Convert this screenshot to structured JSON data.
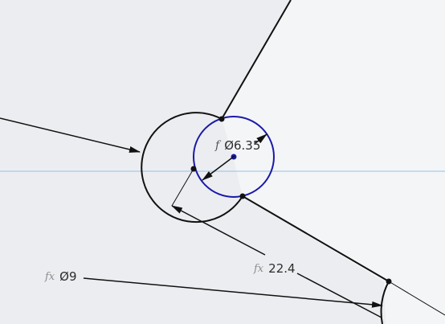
{
  "colors": {
    "background": "#ecedf0",
    "region_fill": "#f4f5f7",
    "geometry": "#111111",
    "selected": "#1a1aa8",
    "axis": "#8fc3e6",
    "dimension": "#111111"
  },
  "dimensions": {
    "selected_diameter": {
      "prefix": "f",
      "value": "Ø6.35"
    },
    "distance": {
      "prefix": "fx",
      "value": "22.4"
    },
    "outer_diameter": {
      "prefix": "fx",
      "value": "Ø9"
    }
  }
}
